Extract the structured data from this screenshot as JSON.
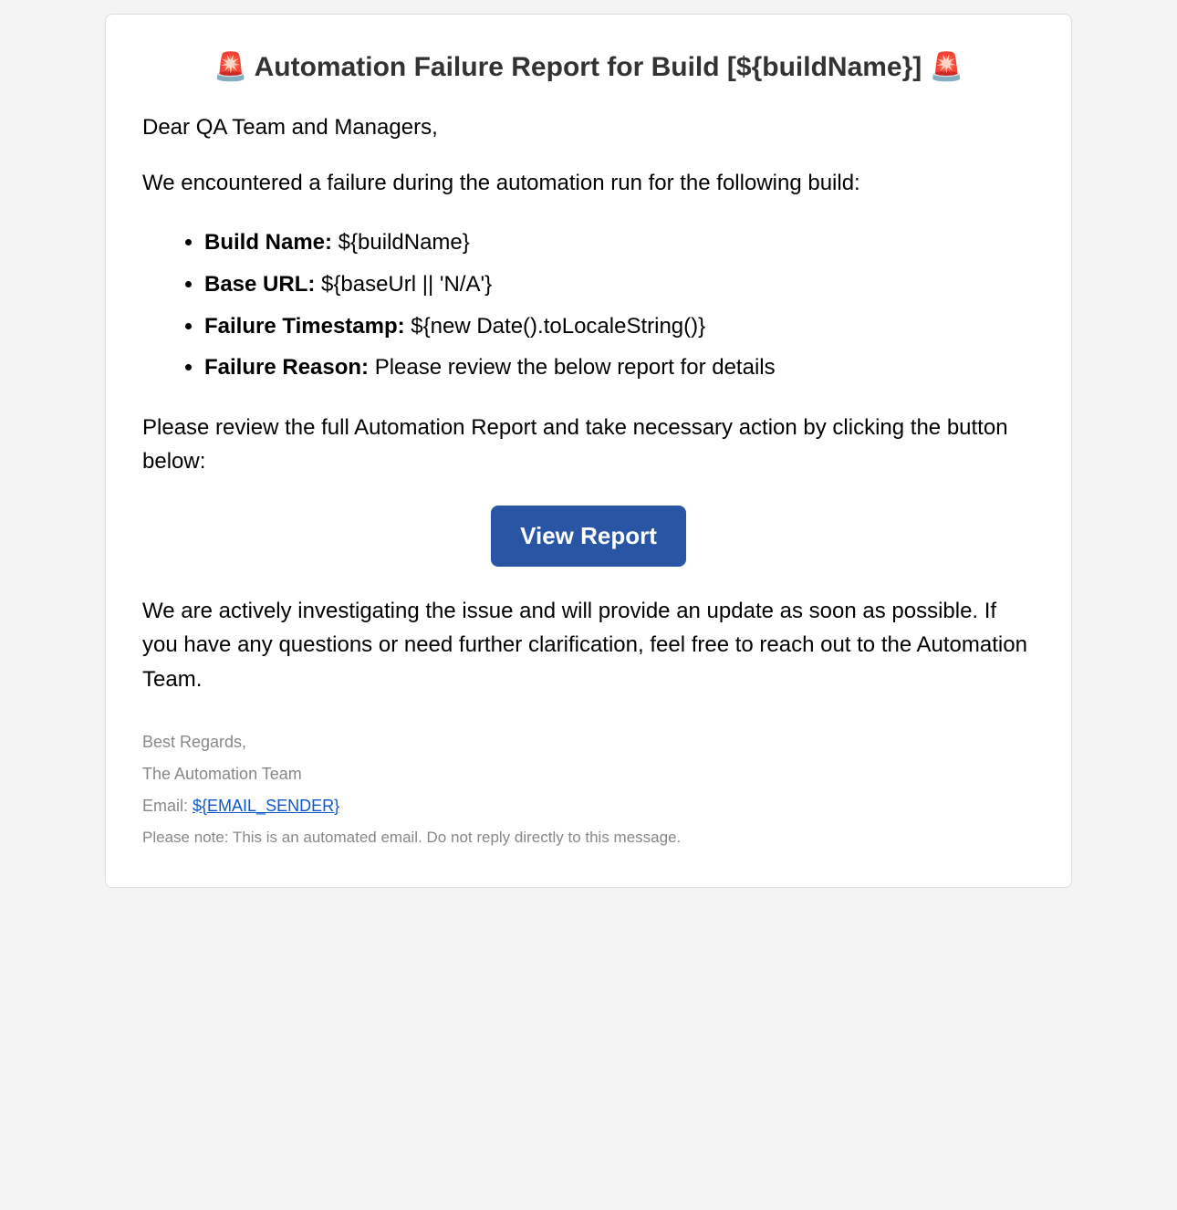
{
  "title": "🚨 Automation Failure Report for Build [${buildName}] 🚨",
  "greeting": "Dear QA Team and Managers,",
  "intro": "We encountered a failure during the automation run for the following build:",
  "details": {
    "buildName": {
      "label": "Build Name:",
      "value": " ${buildName}"
    },
    "baseUrl": {
      "label": "Base URL:",
      "value": " ${baseUrl || 'N/A'}"
    },
    "timestamp": {
      "label": "Failure Timestamp:",
      "value": " ${new Date().toLocaleString()}"
    },
    "reason": {
      "label": "Failure Reason:",
      "value": " Please review the below report for details"
    }
  },
  "instruction": "Please review the full Automation Report and take necessary action by clicking the button below:",
  "button": {
    "label": "View Report"
  },
  "closing": "We are actively investigating the issue and will provide an update as soon as possible. If you have any questions or need further clarification, feel free to reach out to the Automation Team.",
  "footer": {
    "regards": "Best Regards,",
    "team": "The Automation Team",
    "emailLabel": "Email: ",
    "emailValue": "${EMAIL_SENDER}",
    "disclaimer": "Please note: This is an automated email. Do not reply directly to this message."
  }
}
